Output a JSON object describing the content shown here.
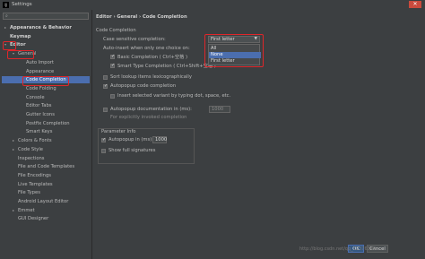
{
  "window": {
    "title": "Settings",
    "app_icon": "IJ"
  },
  "sidebar": {
    "items": [
      {
        "label": "Appearance & Behavior",
        "arrow": "▸",
        "bold": true
      },
      {
        "label": "Keymap",
        "arrow": "",
        "bold": true
      },
      {
        "label": "Editor",
        "arrow": "▾",
        "bold": true
      },
      {
        "label": "General",
        "arrow": "▾"
      },
      {
        "label": "Auto Import"
      },
      {
        "label": "Appearance"
      },
      {
        "label": "Code Completion",
        "selected": true
      },
      {
        "label": "Code Folding"
      },
      {
        "label": "Console"
      },
      {
        "label": "Editor Tabs"
      },
      {
        "label": "Gutter Icons"
      },
      {
        "label": "Postfix Completion"
      },
      {
        "label": "Smart Keys"
      },
      {
        "label": "Colors & Fonts",
        "arrow": "▸"
      },
      {
        "label": "Code Style",
        "arrow": "▸"
      },
      {
        "label": "Inspections"
      },
      {
        "label": "File and Code Templates"
      },
      {
        "label": "File Encodings"
      },
      {
        "label": "Live Templates"
      },
      {
        "label": "File Types"
      },
      {
        "label": "Android Layout Editor"
      },
      {
        "label": "Emmet",
        "arrow": "▸"
      },
      {
        "label": "GUI Designer"
      }
    ]
  },
  "main": {
    "breadcrumb": "Editor › General › Code Completion",
    "section_title": "Code Completion",
    "case_sensitive_label": "Case sensitive completion:",
    "case_sensitive_value": "First letter",
    "case_options": [
      "All",
      "None",
      "First letter"
    ],
    "auto_insert_label": "Auto-insert when only one choice on:",
    "basic_completion": "Basic Completion ( Ctrl+空格 )",
    "smart_type_completion": "Smart Type Completion ( Ctrl+Shift+空格 )",
    "sort_lookup": "Sort lookup items lexicographically",
    "autopopup_code_completion": "Autopopup code completion",
    "insert_selected": "Insert selected variant by typing dot, space, etc.",
    "autopopup_documentation": "Autopopup documentation in (ms):",
    "autopopup_documentation_value": "1000",
    "explicit_hint": "For explicitly invoked completion",
    "parameter_info_title": "Parameter Info",
    "autopopup_in": "Autopopup in (ms):",
    "autopopup_in_value": "1000",
    "show_full_signatures": "Show full signatures"
  },
  "buttons": {
    "ok": "OK",
    "cancel": "Cancel"
  },
  "watermark": "http://blog.csdn.net/qq_32376345",
  "colors": {
    "selection": "#4b6eaf",
    "highlight_border": "#e0262a"
  }
}
